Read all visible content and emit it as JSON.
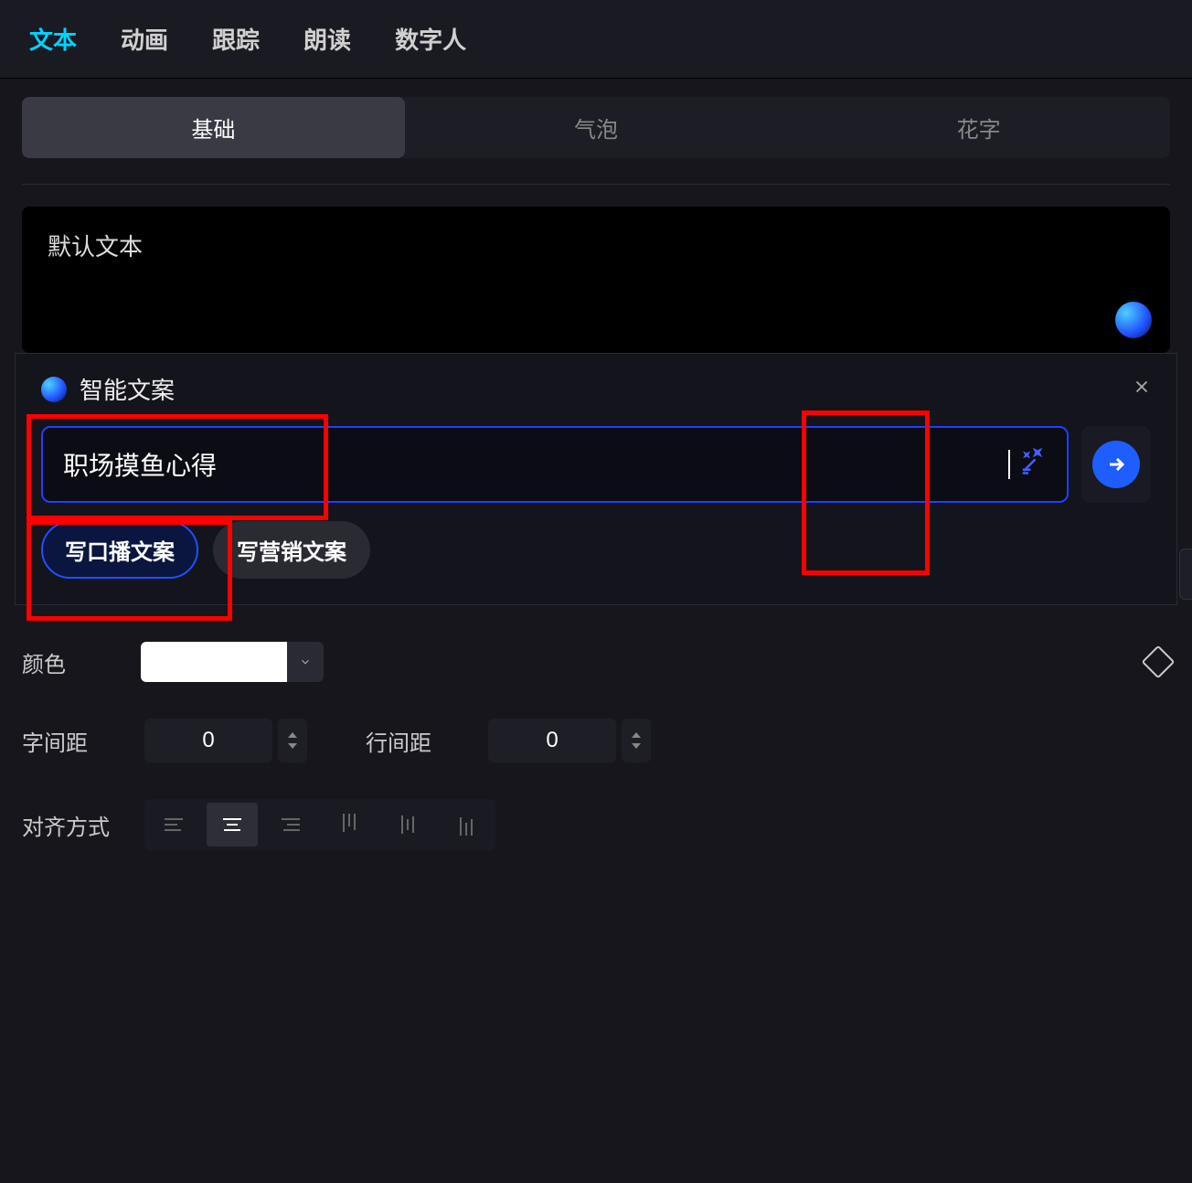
{
  "topTabs": {
    "text": "文本",
    "animation": "动画",
    "tracking": "跟踪",
    "speak": "朗读",
    "avatar": "数字人"
  },
  "subTabs": {
    "basic": "基础",
    "bubble": "气泡",
    "decorated": "花字"
  },
  "textInput": {
    "placeholder": "默认文本"
  },
  "smart": {
    "title": "智能文案",
    "value": "职场摸鱼心得",
    "chip_broadcast": "写口播文案",
    "chip_marketing": "写营销文案"
  },
  "props": {
    "color_label": "颜色",
    "color_value": "#ffffff",
    "letter_spacing_label": "字间距",
    "letter_spacing_value": "0",
    "line_spacing_label": "行间距",
    "line_spacing_value": "0",
    "align_label": "对齐方式"
  }
}
